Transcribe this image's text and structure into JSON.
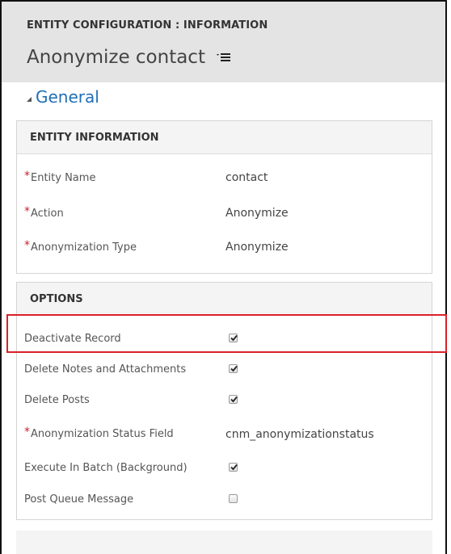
{
  "header": {
    "breadcrumb": "ENTITY CONFIGURATION : INFORMATION",
    "title": "Anonymize contact",
    "menu_icon": "hamburger-menu-icon"
  },
  "section": {
    "label": "General"
  },
  "entity_info": {
    "heading": "ENTITY INFORMATION",
    "fields": [
      {
        "label": "Entity Name",
        "value": "contact",
        "required": true
      },
      {
        "label": "Action",
        "value": "Anonymize",
        "required": true
      },
      {
        "label": "Anonymization Type",
        "value": "Anonymize",
        "required": true
      }
    ]
  },
  "options": {
    "heading": "OPTIONS",
    "fields": [
      {
        "label": "Deactivate Record",
        "checked": true
      },
      {
        "label": "Delete Notes and Attachments",
        "checked": true
      },
      {
        "label": "Delete Posts",
        "checked": true
      },
      {
        "label": "Anonymization Status Field",
        "value": "cnm_anonymizationstatus",
        "required": true
      },
      {
        "label": "Execute In Batch (Background)",
        "checked": true
      },
      {
        "label": "Post Queue Message",
        "checked": false
      }
    ]
  },
  "colors": {
    "accent": "#1f6fb7",
    "required": "#c8232c",
    "highlight": "#d92128",
    "header_bg": "#e4e4e4"
  }
}
